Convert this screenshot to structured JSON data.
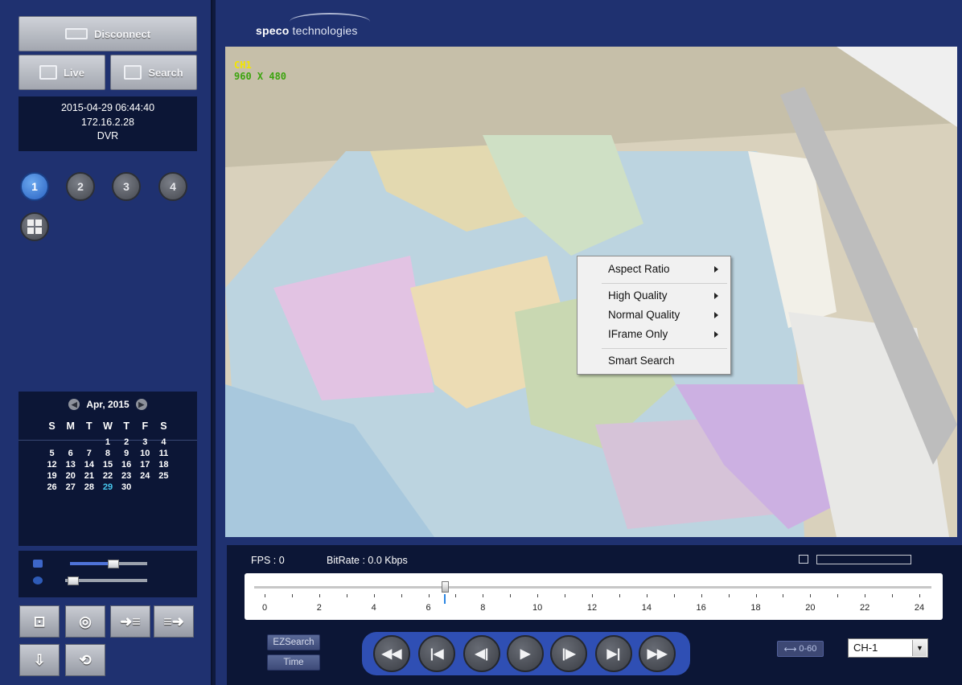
{
  "sidebar": {
    "disconnect_label": "Disconnect",
    "live_label": "Live",
    "search_label": "Search",
    "info": {
      "datetime": "2015-04-29 06:44:40",
      "ip": "172.16.2.28",
      "device": "DVR"
    },
    "channels": [
      "1",
      "2",
      "3",
      "4"
    ],
    "selected_channel": "1",
    "calendar": {
      "month_label": "Apr, 2015",
      "weekdays": [
        "S",
        "M",
        "T",
        "W",
        "T",
        "F",
        "S"
      ],
      "leading_blanks": 3,
      "days": [
        "1",
        "2",
        "3",
        "4",
        "5",
        "6",
        "7",
        "8",
        "9",
        "10",
        "11",
        "12",
        "13",
        "14",
        "15",
        "16",
        "17",
        "18",
        "19",
        "20",
        "21",
        "22",
        "23",
        "24",
        "25",
        "26",
        "27",
        "28",
        "29",
        "30"
      ],
      "today": "29"
    },
    "volume_level": 0.55,
    "zoom_level": 0.05,
    "tools": [
      "snapshot-icon",
      "backup-icon",
      "import-icon",
      "export-icon",
      "download-icon",
      "playback-settings-icon"
    ]
  },
  "header": {
    "brand_bold": "speco",
    "brand_rest": " technologies"
  },
  "video": {
    "channel_label": "CH1",
    "resolution_label": "960 X 480"
  },
  "context_menu": {
    "items": [
      {
        "label": "Aspect Ratio",
        "submenu": true
      },
      {
        "label": "High Quality",
        "submenu": true
      },
      {
        "label": "Normal Quality",
        "submenu": true
      },
      {
        "label": "IFrame Only",
        "submenu": true
      },
      {
        "label": "Smart Search",
        "submenu": false
      }
    ]
  },
  "status": {
    "fps_label": "FPS : 0",
    "bitrate_label": "BitRate : 0.0 Kbps",
    "buffer_level": 0
  },
  "timeline": {
    "labels": [
      "0",
      "2",
      "4",
      "6",
      "8",
      "10",
      "12",
      "14",
      "16",
      "18",
      "20",
      "22",
      "24"
    ],
    "position_hours": 6.6
  },
  "controls": {
    "ezsearch_label": "EZSearch",
    "time_label": "Time",
    "range_label": "0-60",
    "channel_select_value": "CH-1",
    "playback_icons": [
      "fast-rewind-icon",
      "skip-start-icon",
      "step-back-icon",
      "play-icon",
      "step-forward-icon",
      "skip-end-icon",
      "fast-forward-icon"
    ]
  },
  "colors": {
    "panel": "#1f3170",
    "dark_panel": "#0c1636",
    "accent_blue": "#2f4fb4",
    "today": "#48c9f0",
    "ch_label": "#f2e600",
    "res_label": "#3ca40f"
  }
}
